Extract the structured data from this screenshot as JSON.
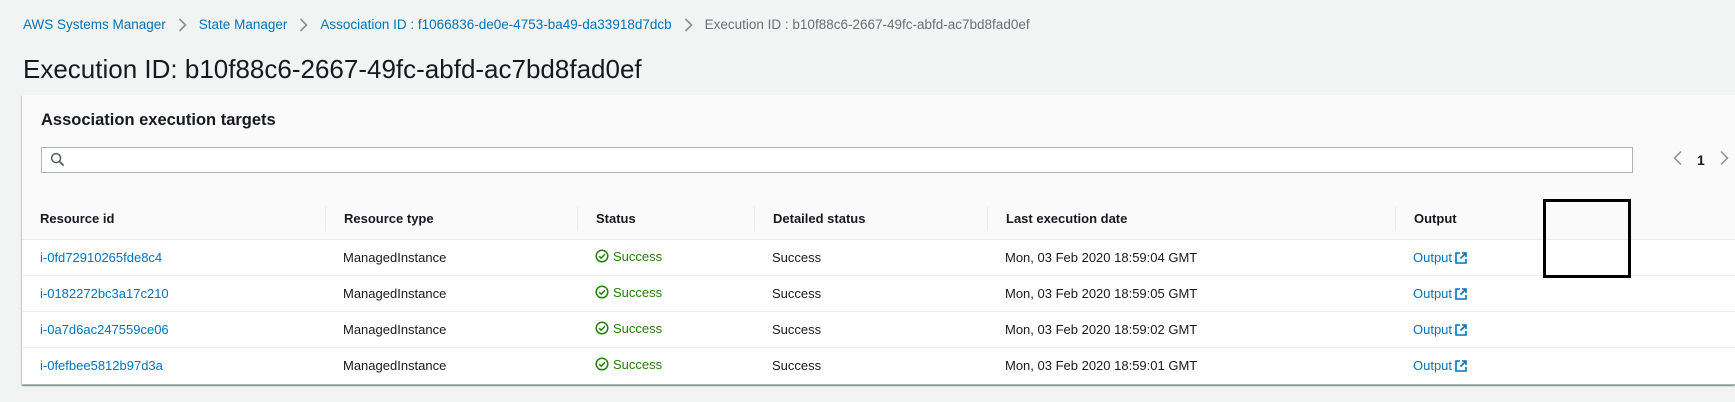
{
  "breadcrumb": {
    "items": [
      {
        "label": "AWS Systems Manager"
      },
      {
        "label": "State Manager"
      },
      {
        "label": "Association ID : f1066836-de0e-4753-ba49-da33918d7dcb"
      },
      {
        "label": "Execution ID : b10f88c6-2667-49fc-abfd-ac7bd8fad0ef"
      }
    ]
  },
  "page_title": "Execution ID: b10f88c6-2667-49fc-abfd-ac7bd8fad0ef",
  "panel": {
    "title": "Association execution targets",
    "search": {
      "value": "",
      "placeholder": ""
    },
    "pagination": {
      "current_page": "1"
    }
  },
  "table": {
    "columns": [
      "Resource id",
      "Resource type",
      "Status",
      "Detailed status",
      "Last execution date",
      "Output"
    ],
    "rows": [
      {
        "resource_id": "i-0fd72910265fde8c4",
        "resource_type": "ManagedInstance",
        "status": "Success",
        "detailed_status": "Success",
        "last_execution": "Mon, 03 Feb 2020 18:59:04 GMT",
        "output": "Output"
      },
      {
        "resource_id": "i-0182272bc3a17c210",
        "resource_type": "ManagedInstance",
        "status": "Success",
        "detailed_status": "Success",
        "last_execution": "Mon, 03 Feb 2020 18:59:05 GMT",
        "output": "Output"
      },
      {
        "resource_id": "i-0a7d6ac247559ce06",
        "resource_type": "ManagedInstance",
        "status": "Success",
        "detailed_status": "Success",
        "last_execution": "Mon, 03 Feb 2020 18:59:02 GMT",
        "output": "Output"
      },
      {
        "resource_id": "i-0fefbee5812b97d3a",
        "resource_type": "ManagedInstance",
        "status": "Success",
        "detailed_status": "Success",
        "last_execution": "Mon, 03 Feb 2020 18:59:01 GMT",
        "output": "Output"
      }
    ]
  },
  "icons": {
    "breadcrumb_separator": "chevron-right-icon",
    "search": "search-icon",
    "status": "check-circle-icon",
    "output": "external-link-icon",
    "prev_page": "chevron-left-icon",
    "next_page": "chevron-right-icon"
  },
  "colors": {
    "link": "#0073bb",
    "success": "#1d8102",
    "background": "#f2f3f3"
  }
}
